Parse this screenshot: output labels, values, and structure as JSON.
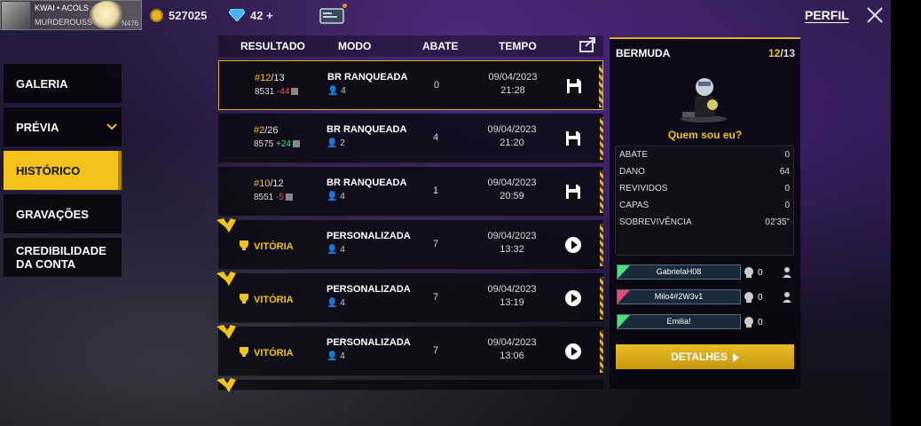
{
  "header": {
    "player_name": "KWAI • ACOLS",
    "clan": "MURDEROUSS",
    "level_badge": "N476",
    "coins": "527025",
    "diamonds": "42 +",
    "profile_tab": "PERFIL"
  },
  "nav": {
    "items": [
      {
        "label": "GALERIA"
      },
      {
        "label": "PRÉVIA"
      },
      {
        "label": "HISTÓRICO"
      },
      {
        "label": "GRAVAÇÕES"
      },
      {
        "line1": "CREDIBILIDADE",
        "line2": "DA CONTA"
      }
    ]
  },
  "table": {
    "headers": {
      "result": "RESULTADO",
      "mode": "MODO",
      "kills": "ABATE",
      "time": "TEMPO"
    },
    "rows": [
      {
        "type": "rank",
        "rank": "#12",
        "total": "/13",
        "points": "8531",
        "delta": "-44",
        "delta_sign": "neg",
        "mode": "BR RANQUEADA",
        "squad": "4",
        "kills": "0",
        "date": "09/04/2023",
        "time": "21:28",
        "action": "save-icon"
      },
      {
        "type": "rank",
        "rank": "#2",
        "total": "/26",
        "points": "8575",
        "delta": "+24",
        "delta_sign": "pos",
        "mode": "BR RANQUEADA",
        "squad": "2",
        "kills": "4",
        "date": "09/04/2023",
        "time": "21:20",
        "action": "save-icon"
      },
      {
        "type": "rank",
        "rank": "#10",
        "total": "/12",
        "points": "8551",
        "delta": "-5",
        "delta_sign": "neg",
        "mode": "BR RANQUEADA",
        "squad": "4",
        "kills": "1",
        "date": "09/04/2023",
        "time": "20:59",
        "action": "save-icon"
      },
      {
        "type": "victory",
        "result": "VITÓRIA",
        "mode": "PERSONALIZADA",
        "squad": "4",
        "kills": "7",
        "date": "09/04/2023",
        "time": "13:32",
        "action": "play-icon"
      },
      {
        "type": "victory",
        "result": "VITÓRIA",
        "mode": "PERSONALIZADA",
        "squad": "4",
        "kills": "7",
        "date": "09/04/2023",
        "time": "13:19",
        "action": "play-icon"
      },
      {
        "type": "victory",
        "result": "VITÓRIA",
        "mode": "PERSONALIZADA",
        "squad": "4",
        "kills": "7",
        "date": "09/04/2023",
        "time": "13:06",
        "action": "play-icon"
      }
    ]
  },
  "panel": {
    "map": "BERMUDA",
    "placement": "12",
    "placement_total": "/13",
    "character_caption": "Quem sou eu?",
    "stats": [
      {
        "label": "ABATE",
        "value": "0"
      },
      {
        "label": "DANO",
        "value": "64"
      },
      {
        "label": "REVIVIDOS",
        "value": "0"
      },
      {
        "label": "CAPAS",
        "value": "0"
      },
      {
        "label": "SOBREVIVÊNCIA",
        "value": "02'35\""
      }
    ],
    "teammates": [
      {
        "name": "GabrielaH08",
        "kills": "0",
        "tag_color": "#4be07a"
      },
      {
        "name": "Milo4#2W3v1",
        "kills": "0",
        "tag_color": "#e04b7a"
      },
      {
        "name": "Emilia!",
        "kills": "0",
        "tag_color": "#4be07a"
      }
    ],
    "details_button": "DETALHES"
  },
  "colors": {
    "accent": "#f2c21a",
    "negative": "#ff4d4d",
    "positive": "#4be07a"
  }
}
